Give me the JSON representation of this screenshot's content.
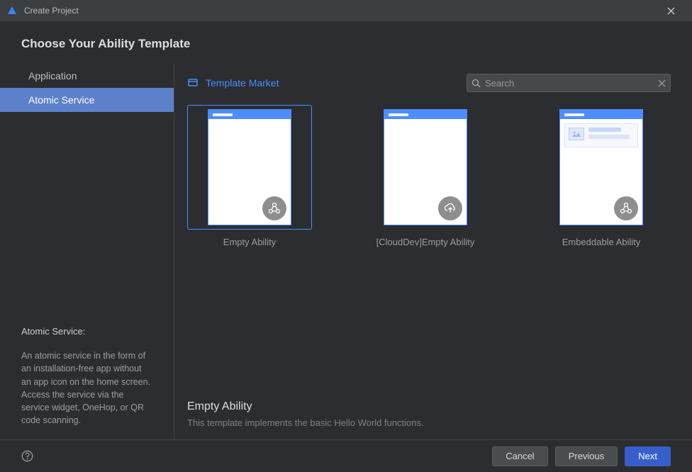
{
  "window": {
    "title": "Create Project"
  },
  "header": {
    "page_title": "Choose Your Ability Template"
  },
  "sidebar": {
    "items": [
      {
        "label": "Application",
        "selected": false
      },
      {
        "label": "Atomic Service",
        "selected": true
      }
    ],
    "info": {
      "title": "Atomic Service:",
      "body": "An atomic service in the form of an installation-free app without an app icon on the home screen. Access the service via the service widget, OneHop, or QR code scanning."
    }
  },
  "content": {
    "market_link": "Template Market",
    "search": {
      "placeholder": "Search",
      "value": ""
    },
    "templates": [
      {
        "label": "Empty Ability",
        "badge_icon": "nodes-icon",
        "selected": true
      },
      {
        "label": "[CloudDev]Empty Ability",
        "badge_icon": "cloud-upload-icon",
        "selected": false
      },
      {
        "label": "Embeddable Ability",
        "badge_icon": "nodes-icon",
        "selected": false,
        "embed_preview": true
      }
    ],
    "selected_template": {
      "title": "Empty Ability",
      "description": "This template implements the basic Hello World functions."
    }
  },
  "footer": {
    "cancel": "Cancel",
    "previous": "Previous",
    "next": "Next"
  }
}
